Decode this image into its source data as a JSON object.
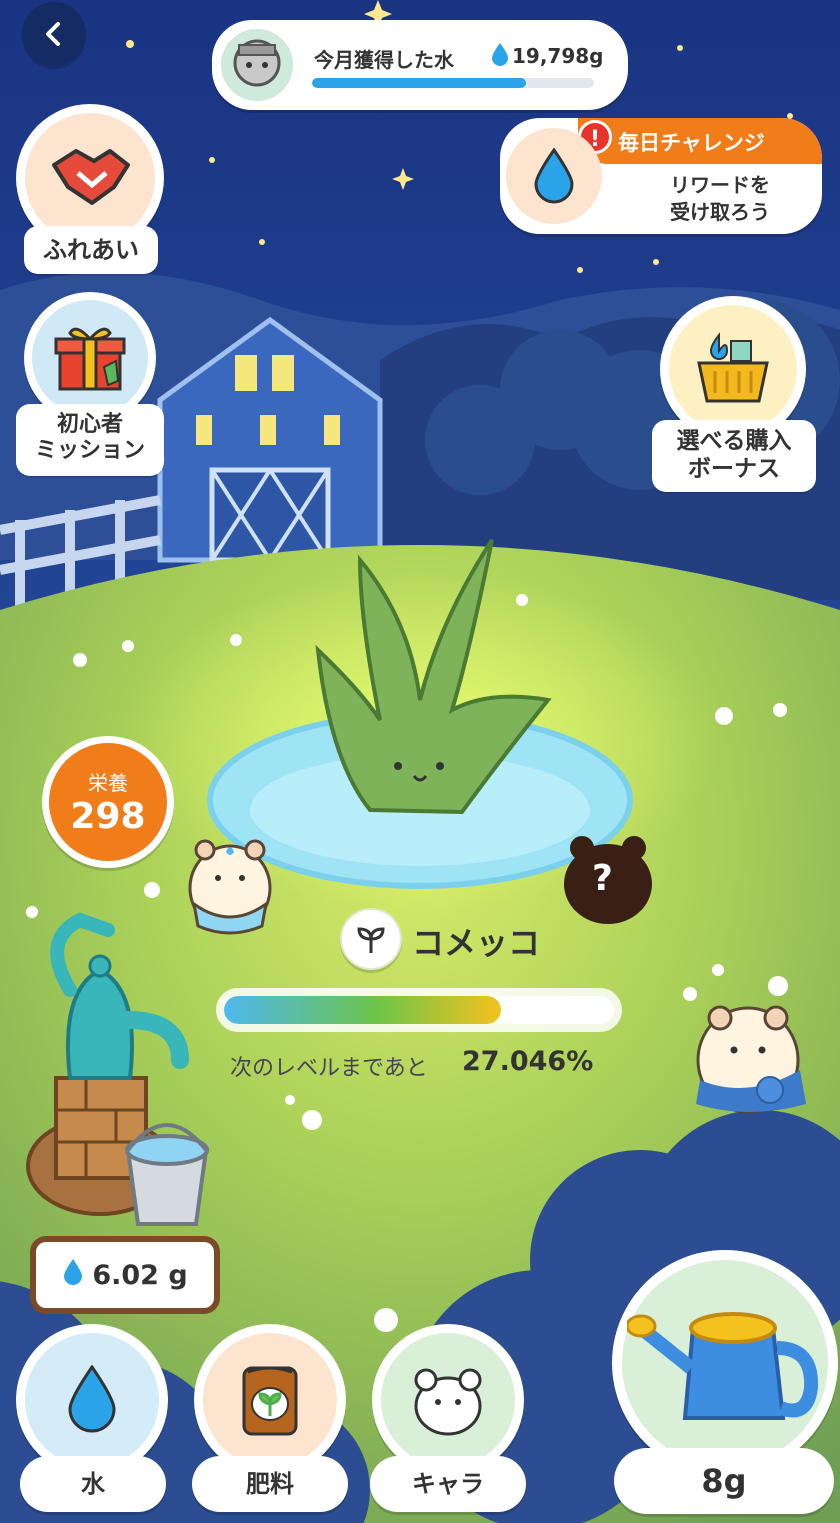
{
  "header": {
    "monthly_water_title": "今月獲得した水",
    "monthly_water_amount": "19,798g",
    "monthly_water_progress": 0.76
  },
  "left_menu": {
    "fureai_label": "ふれあい",
    "beginner_label_line1": "初心者",
    "beginner_label_line2": "ミッション"
  },
  "right_menu": {
    "daily_title": "毎日チャレンジ",
    "daily_alert": "!",
    "daily_text_line1": "リワードを",
    "daily_text_line2": "受け取ろう",
    "bonus_label_line1": "選べる購入",
    "bonus_label_line2": "ボーナス"
  },
  "nutrition": {
    "label": "栄養",
    "value": "298"
  },
  "plant": {
    "name": "コメッコ",
    "level_text": "次のレベルまであと",
    "level_percent": "27.046%",
    "level_progress": 0.71
  },
  "unknown_character_mark": "?",
  "water_stock": "6.02 g",
  "bottom_bar": {
    "water_label": "水",
    "fertilizer_label": "肥料",
    "character_label": "キャラ",
    "watering_amount": "8g"
  },
  "colors": {
    "accent_orange": "#f07c1a",
    "water_blue": "#2aa3e8",
    "sky_top": "#1d3a8a",
    "grass": "#a9cf52"
  }
}
